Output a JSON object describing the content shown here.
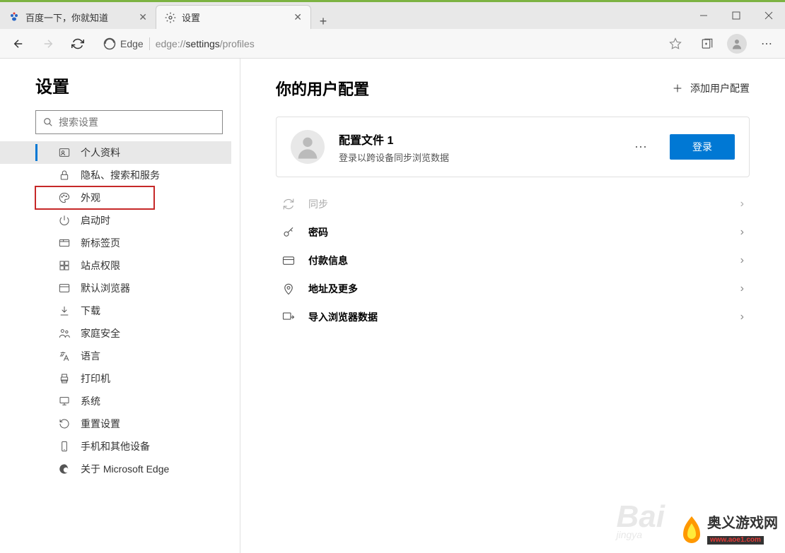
{
  "tabs": [
    {
      "title": "百度一下，你就知道"
    },
    {
      "title": "设置"
    }
  ],
  "toolbar": {
    "edge_label": "Edge",
    "url_prefix": "edge://",
    "url_mid": "settings",
    "url_suffix": "/profiles"
  },
  "sidebar": {
    "title": "设置",
    "search_placeholder": "搜索设置",
    "items": [
      {
        "label": "个人资料"
      },
      {
        "label": "隐私、搜索和服务"
      },
      {
        "label": "外观"
      },
      {
        "label": "启动时"
      },
      {
        "label": "新标签页"
      },
      {
        "label": "站点权限"
      },
      {
        "label": "默认浏览器"
      },
      {
        "label": "下载"
      },
      {
        "label": "家庭安全"
      },
      {
        "label": "语言"
      },
      {
        "label": "打印机"
      },
      {
        "label": "系统"
      },
      {
        "label": "重置设置"
      },
      {
        "label": "手机和其他设备"
      },
      {
        "label": "关于 Microsoft Edge"
      }
    ]
  },
  "content": {
    "heading": "你的用户配置",
    "add_profile": "添加用户配置",
    "profile": {
      "name": "配置文件 1",
      "desc": "登录以跨设备同步浏览数据",
      "login": "登录"
    },
    "rows": [
      {
        "label": "同步"
      },
      {
        "label": "密码"
      },
      {
        "label": "付款信息"
      },
      {
        "label": "地址及更多"
      },
      {
        "label": "导入浏览器数据"
      }
    ]
  },
  "watermark": {
    "baidu": "Bai",
    "baidu_sub": "jingya",
    "logo_text": "奥义游戏网",
    "logo_url": "www.aoe1.com"
  }
}
